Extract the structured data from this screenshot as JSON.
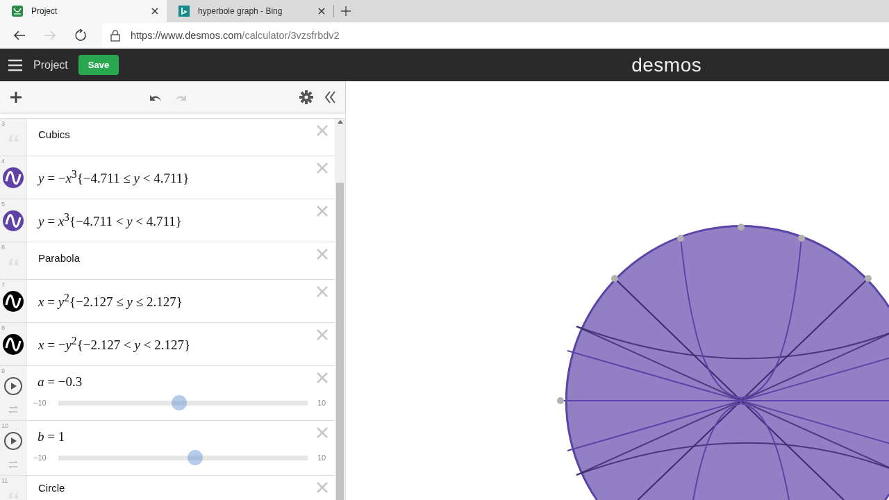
{
  "browser": {
    "tabs": [
      {
        "title": "Project",
        "kind": "desmos",
        "selected": true
      },
      {
        "title": "hyperbole graph - Bing",
        "kind": "bing",
        "selected": false
      }
    ],
    "nav": {
      "back_disabled": false,
      "forward_disabled": true
    },
    "url": {
      "host": "https://www.desmos.com",
      "path": "/calculator/3vzsfrbdv2"
    }
  },
  "header": {
    "title": "Project",
    "save": "Save",
    "logo": "desmos"
  },
  "toolbar": {
    "undo_disabled": false,
    "redo_disabled": true
  },
  "expressions": [
    {
      "kind": "note",
      "number": "3",
      "text": "Cubics"
    },
    {
      "kind": "expression",
      "number": "4",
      "color": "#6042a6",
      "latex": "*y* = −*x*$^{3}${−4.711 ≤ *y* < 4.711}"
    },
    {
      "kind": "expression",
      "number": "5",
      "color": "#6042a6",
      "latex": "*y* = *x*$^{3}${−4.711 < *y* < 4.711}"
    },
    {
      "kind": "note",
      "number": "6",
      "text": "Parabola"
    },
    {
      "kind": "expression",
      "number": "7",
      "color": "#000000",
      "latex": "*x* = *y*$^{2}${−2.127 ≤ *y* ≤ 2.127}"
    },
    {
      "kind": "expression",
      "number": "8",
      "color": "#000000",
      "latex": "*x* = −*y*$^{2}${−2.127 < *y* < 2.127}"
    },
    {
      "kind": "slider",
      "number": "9",
      "latex": "*a* = −0.3",
      "min": "−10",
      "max": "10",
      "level": 0.485
    },
    {
      "kind": "slider",
      "number": "10",
      "latex": "*b* = 1",
      "min": "−10",
      "max": "10",
      "level": 0.55
    },
    {
      "kind": "note",
      "number": "11",
      "text": "Circle"
    }
  ]
}
